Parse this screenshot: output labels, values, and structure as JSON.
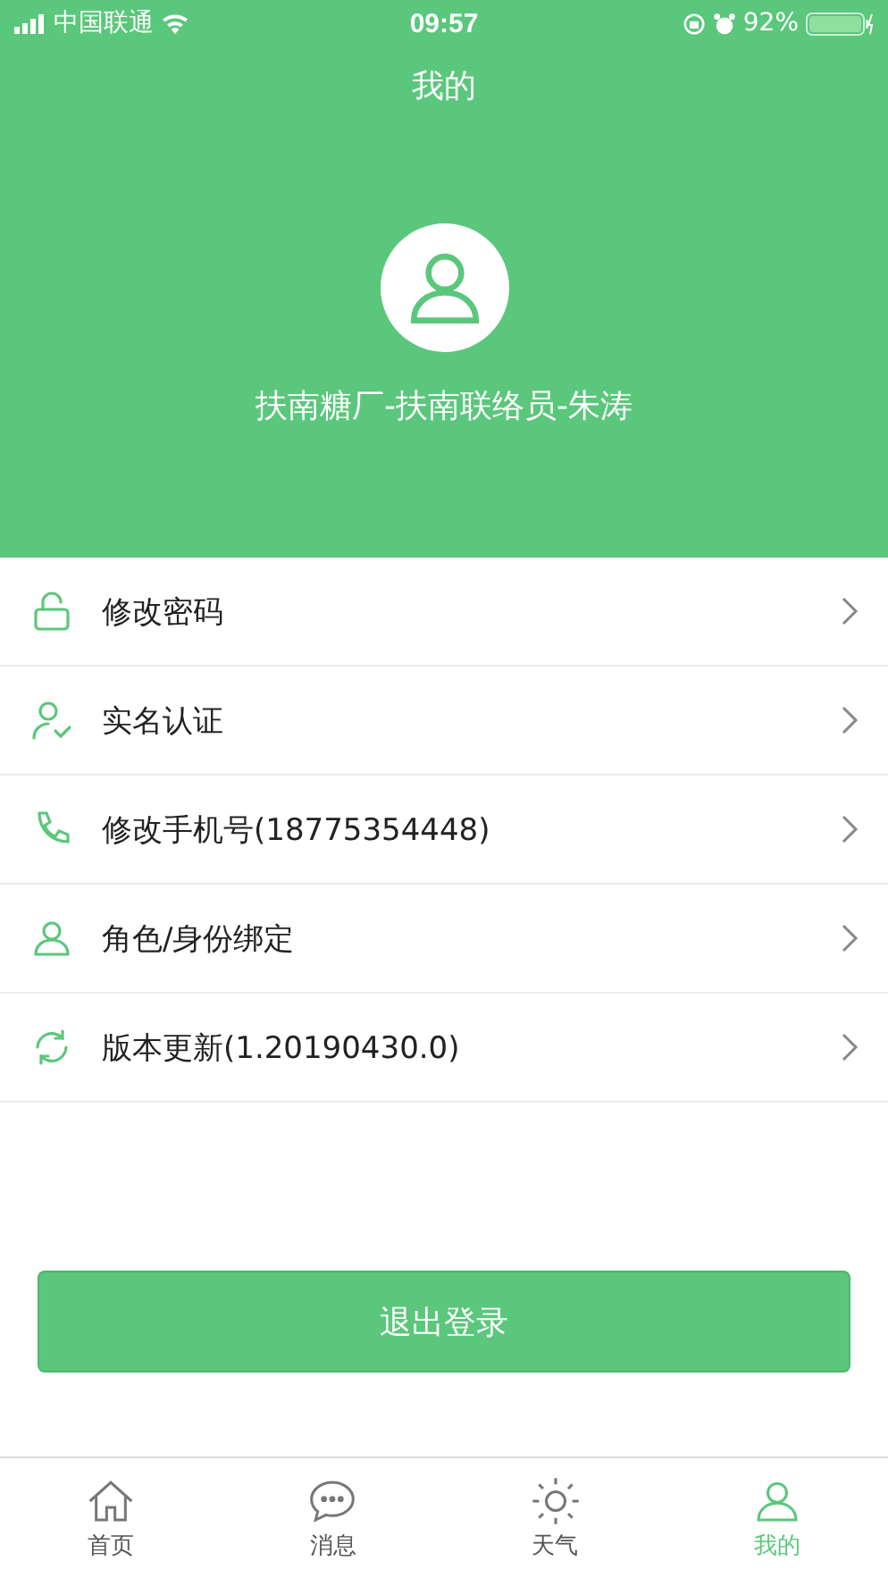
{
  "status_bar": {
    "carrier": "中国联通",
    "time": "09:57",
    "battery": "92%"
  },
  "header": {
    "title": "我的",
    "user_name": "扶南糖厂-扶南联络员-朱涛"
  },
  "menu": [
    {
      "kind": "lock",
      "label": "修改密码"
    },
    {
      "kind": "verify",
      "label": "实名认证"
    },
    {
      "kind": "phone",
      "label": "修改手机号(18775354448)"
    },
    {
      "kind": "user",
      "label": "角色/身份绑定"
    },
    {
      "kind": "refresh",
      "label": "版本更新(1.20190430.0)"
    }
  ],
  "logout_button": "退出登录",
  "tab_bar": [
    {
      "kind": "home",
      "label": "首页",
      "selected": false
    },
    {
      "kind": "chat",
      "label": "消息",
      "selected": false
    },
    {
      "kind": "sun",
      "label": "天气",
      "selected": false
    },
    {
      "kind": "user",
      "label": "我的",
      "selected": true
    }
  ]
}
